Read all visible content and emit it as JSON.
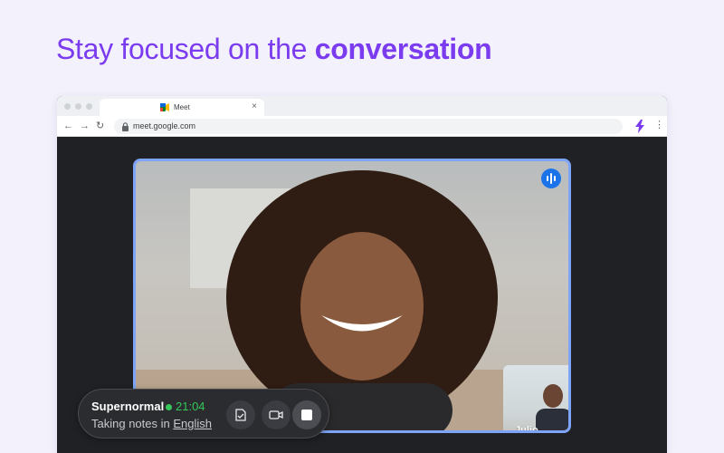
{
  "headline": {
    "normal": "Stay focused on the ",
    "bold": "conversation"
  },
  "browser": {
    "tab": {
      "title": "Meet",
      "close": "×"
    },
    "toolbar": {
      "back": "←",
      "forward": "→",
      "reload": "↻",
      "url": "meet.google.com",
      "menu": "⋮"
    },
    "icons": {
      "favicon": "google-meet-icon",
      "lock": "lock-icon",
      "extension": "supernormal-extension-icon"
    }
  },
  "meeting": {
    "main_speaking": "audio-wave-icon",
    "pip": {
      "name": "Julio",
      "speaking": "audio-wave-icon"
    }
  },
  "supernormal": {
    "title": "Supernormal",
    "timer": "21:04",
    "status_prefix": "Taking notes in ",
    "language": "English",
    "buttons": [
      "notes-icon",
      "camera-icon",
      "stop-icon"
    ]
  },
  "colors": {
    "accent": "#7b3cf0",
    "speaking_border": "#7ea4f7",
    "speaking_badge": "#1a73e8",
    "recording_green": "#34c759"
  }
}
